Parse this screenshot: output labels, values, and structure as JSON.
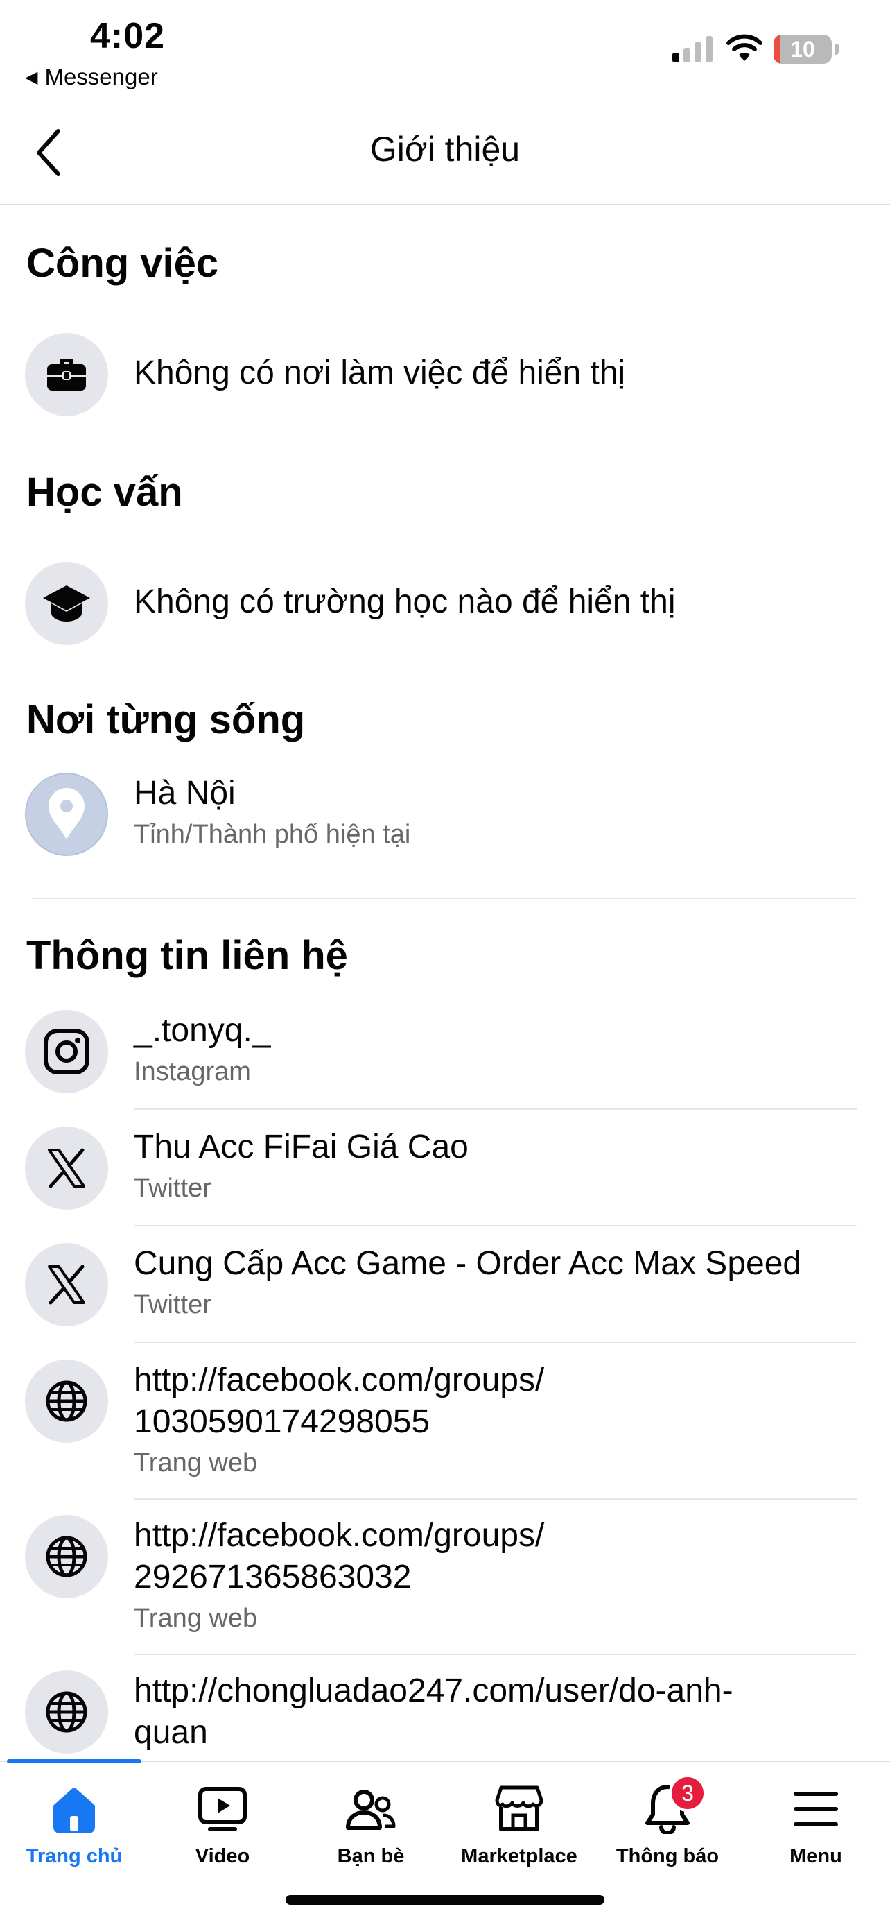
{
  "status_bar": {
    "time": "4:02",
    "back_app": "Messenger",
    "battery": "10",
    "battery_fraction": 0.1,
    "battery_color": "#eb4e3d"
  },
  "nav": {
    "title": "Giới thiệu",
    "back_icon": "chevron-left-icon"
  },
  "sections": {
    "work": {
      "title": "Công việc",
      "icon": "briefcase-icon",
      "text": "Không có nơi làm việc để hiển thị"
    },
    "education": {
      "title": "Học vấn",
      "icon": "graduation-cap-icon",
      "text": "Không có trường học nào để hiển thị"
    },
    "places": {
      "title": "Nơi từng sống",
      "icon": "map-pin-icon",
      "text": "Hà Nội",
      "sub": "Tỉnh/Thành phố hiện tại"
    },
    "contact": {
      "title": "Thông tin liên hệ",
      "items": [
        {
          "icon": "instagram-icon",
          "text": "_.tonyq._",
          "sub": "Instagram"
        },
        {
          "icon": "x-twitter-icon",
          "text": "Thu Acc FiFai Giá Cao",
          "sub": "Twitter"
        },
        {
          "icon": "x-twitter-icon",
          "text": "Cung Cấp Acc Game - Order Acc Max Speed",
          "sub": "Twitter"
        },
        {
          "icon": "globe-icon",
          "line1": "http://facebook.com/groups/",
          "line2": "1030590174298055",
          "sub": "Trang web"
        },
        {
          "icon": "globe-icon",
          "line1": "http://facebook.com/groups/",
          "line2": "292671365863032",
          "sub": "Trang web"
        },
        {
          "icon": "globe-icon",
          "line1": "http://chongluadao247.com/user/do-anh-",
          "line2": "quan"
        }
      ]
    }
  },
  "tab_bar": {
    "accent": "#1877f2",
    "tabs": [
      {
        "label": "Trang chủ",
        "icon": "home-icon",
        "active": true
      },
      {
        "label": "Video",
        "icon": "video-icon"
      },
      {
        "label": "Bạn bè",
        "icon": "friends-icon"
      },
      {
        "label": "Marketplace",
        "icon": "marketplace-icon"
      },
      {
        "label": "Thông báo",
        "icon": "bell-icon",
        "badge": "3"
      },
      {
        "label": "Menu",
        "icon": "menu-icon"
      }
    ]
  }
}
